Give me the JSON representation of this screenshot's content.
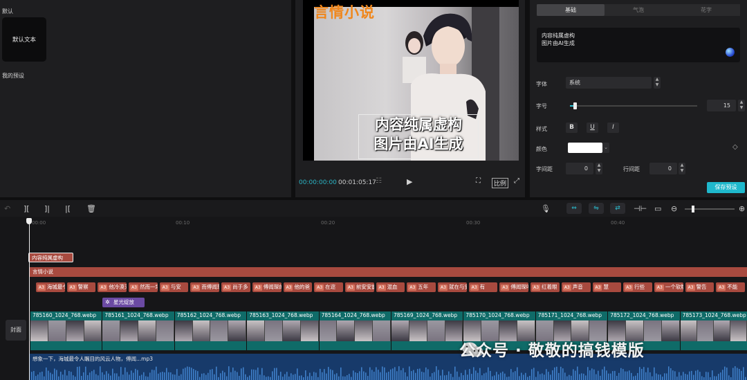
{
  "left_panel": {
    "section_default": "默认",
    "default_card": "默认文本",
    "section_presets": "我的预设"
  },
  "preview": {
    "brand": "言情小说",
    "overlay_line1": "内容纯属虚构",
    "overlay_line2": "图片由AI生成",
    "current_time": "00:00:00:00",
    "total_time": "00:01:05:17",
    "ratio_label": "比例"
  },
  "inspector": {
    "tabs": [
      {
        "label": "基础",
        "active": true
      },
      {
        "label": "气泡",
        "active": false
      },
      {
        "label": "花字",
        "active": false
      }
    ],
    "text_line1": "内容纯属虚构",
    "text_line2": "图片由AI生成",
    "font_label": "字体",
    "font_value": "系统",
    "size_label": "字号",
    "size_value": "15",
    "size_slider_fraction": 0.03,
    "style_label": "样式",
    "style_bold": "B",
    "style_underline": "U",
    "style_italic": "I",
    "color_label": "颜色",
    "color_value": "#ffffff",
    "letter_spacing_label": "字间距",
    "letter_spacing_value": "0",
    "line_spacing_label": "行间距",
    "line_spacing_value": "0",
    "save_preset": "保存预设"
  },
  "timeline": {
    "ticks": [
      "00:00",
      "00:10",
      "00:20",
      "00:30",
      "00:40"
    ],
    "text_clip": "内容纯属虚构",
    "title_track": "言情小说",
    "subtitles": [
      "海城最令人闻",
      "警察",
      "他冷漠天才",
      "然而一场意外过",
      "与安",
      "而傅闻琛",
      "尚于多",
      "傅闻琛的",
      "他的爸",
      "在迩",
      "前安安能",
      "混血",
      "五年",
      "就在与安",
      "有",
      "傅闻琛听",
      "红着眼",
      "声音",
      "慧",
      "行些",
      "一个软糯的",
      "警告",
      "不能"
    ],
    "subtitle_tag": "A3",
    "effect": "星光绽放",
    "cover_label": "封面",
    "video_clips": [
      "785160_1024_768.webp",
      "785161_1024_768.webp",
      "785162_1024_768.webp",
      "785163_1024_768.webp",
      "785164_1024_768.webp",
      "785169_1024_768.webp",
      "785170_1024_768.webp",
      "785171_1024_768.webp",
      "785172_1024_768.webp",
      "785173_1024_768.webp"
    ],
    "audio_name": "想象一下，海城最令人瞩目的风云人物，傅闻...mp3"
  },
  "watermark": "公众号 · 敬敬的搞钱模版",
  "colors": {
    "accent": "#2bc3d6",
    "brand_orange": "#f0861a",
    "text_clip": "#a84a3f",
    "video_track": "#0f6b68",
    "audio_track": "#173a6a",
    "effect": "#6b4aa3"
  }
}
